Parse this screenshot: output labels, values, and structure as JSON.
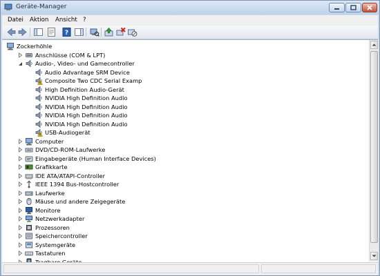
{
  "window": {
    "title": "Geräte-Manager"
  },
  "menu": [
    "Datei",
    "Aktion",
    "Ansicht",
    "?"
  ],
  "toolbar_icons": [
    "back-arrow-icon",
    "forward-arrow-icon",
    "show-hide-console-tree-icon",
    "properties-icon",
    "help-icon",
    "action-pane-icon",
    "scan-hardware-icon",
    "update-driver-icon",
    "uninstall-icon",
    "disable-icon"
  ],
  "tree": {
    "root": {
      "label": "Zockerhöhle",
      "expanded": true,
      "icon": "computer-icon"
    },
    "categories": [
      {
        "label": "Anschlüsse (COM & LPT)",
        "icon": "port-icon",
        "expanded": false
      },
      {
        "label": "Audio-, Video- und Gamecontroller",
        "icon": "speaker-icon",
        "expanded": true,
        "children": [
          {
            "label": "Audio Advantage SRM Device",
            "icon": "speaker-icon",
            "warning": false
          },
          {
            "label": "Composite Two CDC Serial Examp",
            "icon": "speaker-icon",
            "warning": true
          },
          {
            "label": "High Definition Audio-Gerät",
            "icon": "speaker-icon",
            "warning": false
          },
          {
            "label": "NVIDIA High Definition Audio",
            "icon": "speaker-icon",
            "warning": false
          },
          {
            "label": "NVIDIA High Definition Audio",
            "icon": "speaker-icon",
            "warning": false
          },
          {
            "label": "NVIDIA High Definition Audio",
            "icon": "speaker-icon",
            "warning": false
          },
          {
            "label": "NVIDIA High Definition Audio",
            "icon": "speaker-icon",
            "warning": false
          },
          {
            "label": "USB-Audiogerät",
            "icon": "speaker-icon",
            "warning": true
          }
        ]
      },
      {
        "label": "Computer",
        "icon": "computer-icon",
        "expanded": false
      },
      {
        "label": "DVD/CD-ROM-Laufwerke",
        "icon": "dvd-drive-icon",
        "expanded": false
      },
      {
        "label": "Eingabegeräte (Human Interface Devices)",
        "icon": "hid-icon",
        "expanded": false
      },
      {
        "label": "Grafikkarte",
        "icon": "display-adapter-icon",
        "expanded": false
      },
      {
        "label": "IDE ATA/ATAPI-Controller",
        "icon": "ide-controller-icon",
        "expanded": false
      },
      {
        "label": "IEEE 1394 Bus-Hostcontroller",
        "icon": "firewire-icon",
        "expanded": false
      },
      {
        "label": "Laufwerke",
        "icon": "disk-drive-icon",
        "expanded": false
      },
      {
        "label": "Mäuse und andere Zeigegeräte",
        "icon": "mouse-icon",
        "expanded": false
      },
      {
        "label": "Monitore",
        "icon": "monitor-icon",
        "expanded": false
      },
      {
        "label": "Netzwerkadapter",
        "icon": "network-adapter-icon",
        "expanded": false
      },
      {
        "label": "Prozessoren",
        "icon": "processor-icon",
        "expanded": false
      },
      {
        "label": "Speichercontroller",
        "icon": "storage-controller-icon",
        "expanded": false
      },
      {
        "label": "Systemgeräte",
        "icon": "system-device-icon",
        "expanded": false
      },
      {
        "label": "Tastaturen",
        "icon": "keyboard-icon",
        "expanded": false
      },
      {
        "label": "Tragbare Geräte",
        "icon": "portable-device-icon",
        "expanded": false
      }
    ]
  },
  "colors": {
    "title_bar": "#c9d9ee",
    "warning": "#f2c200",
    "close_button": "#c55236"
  }
}
